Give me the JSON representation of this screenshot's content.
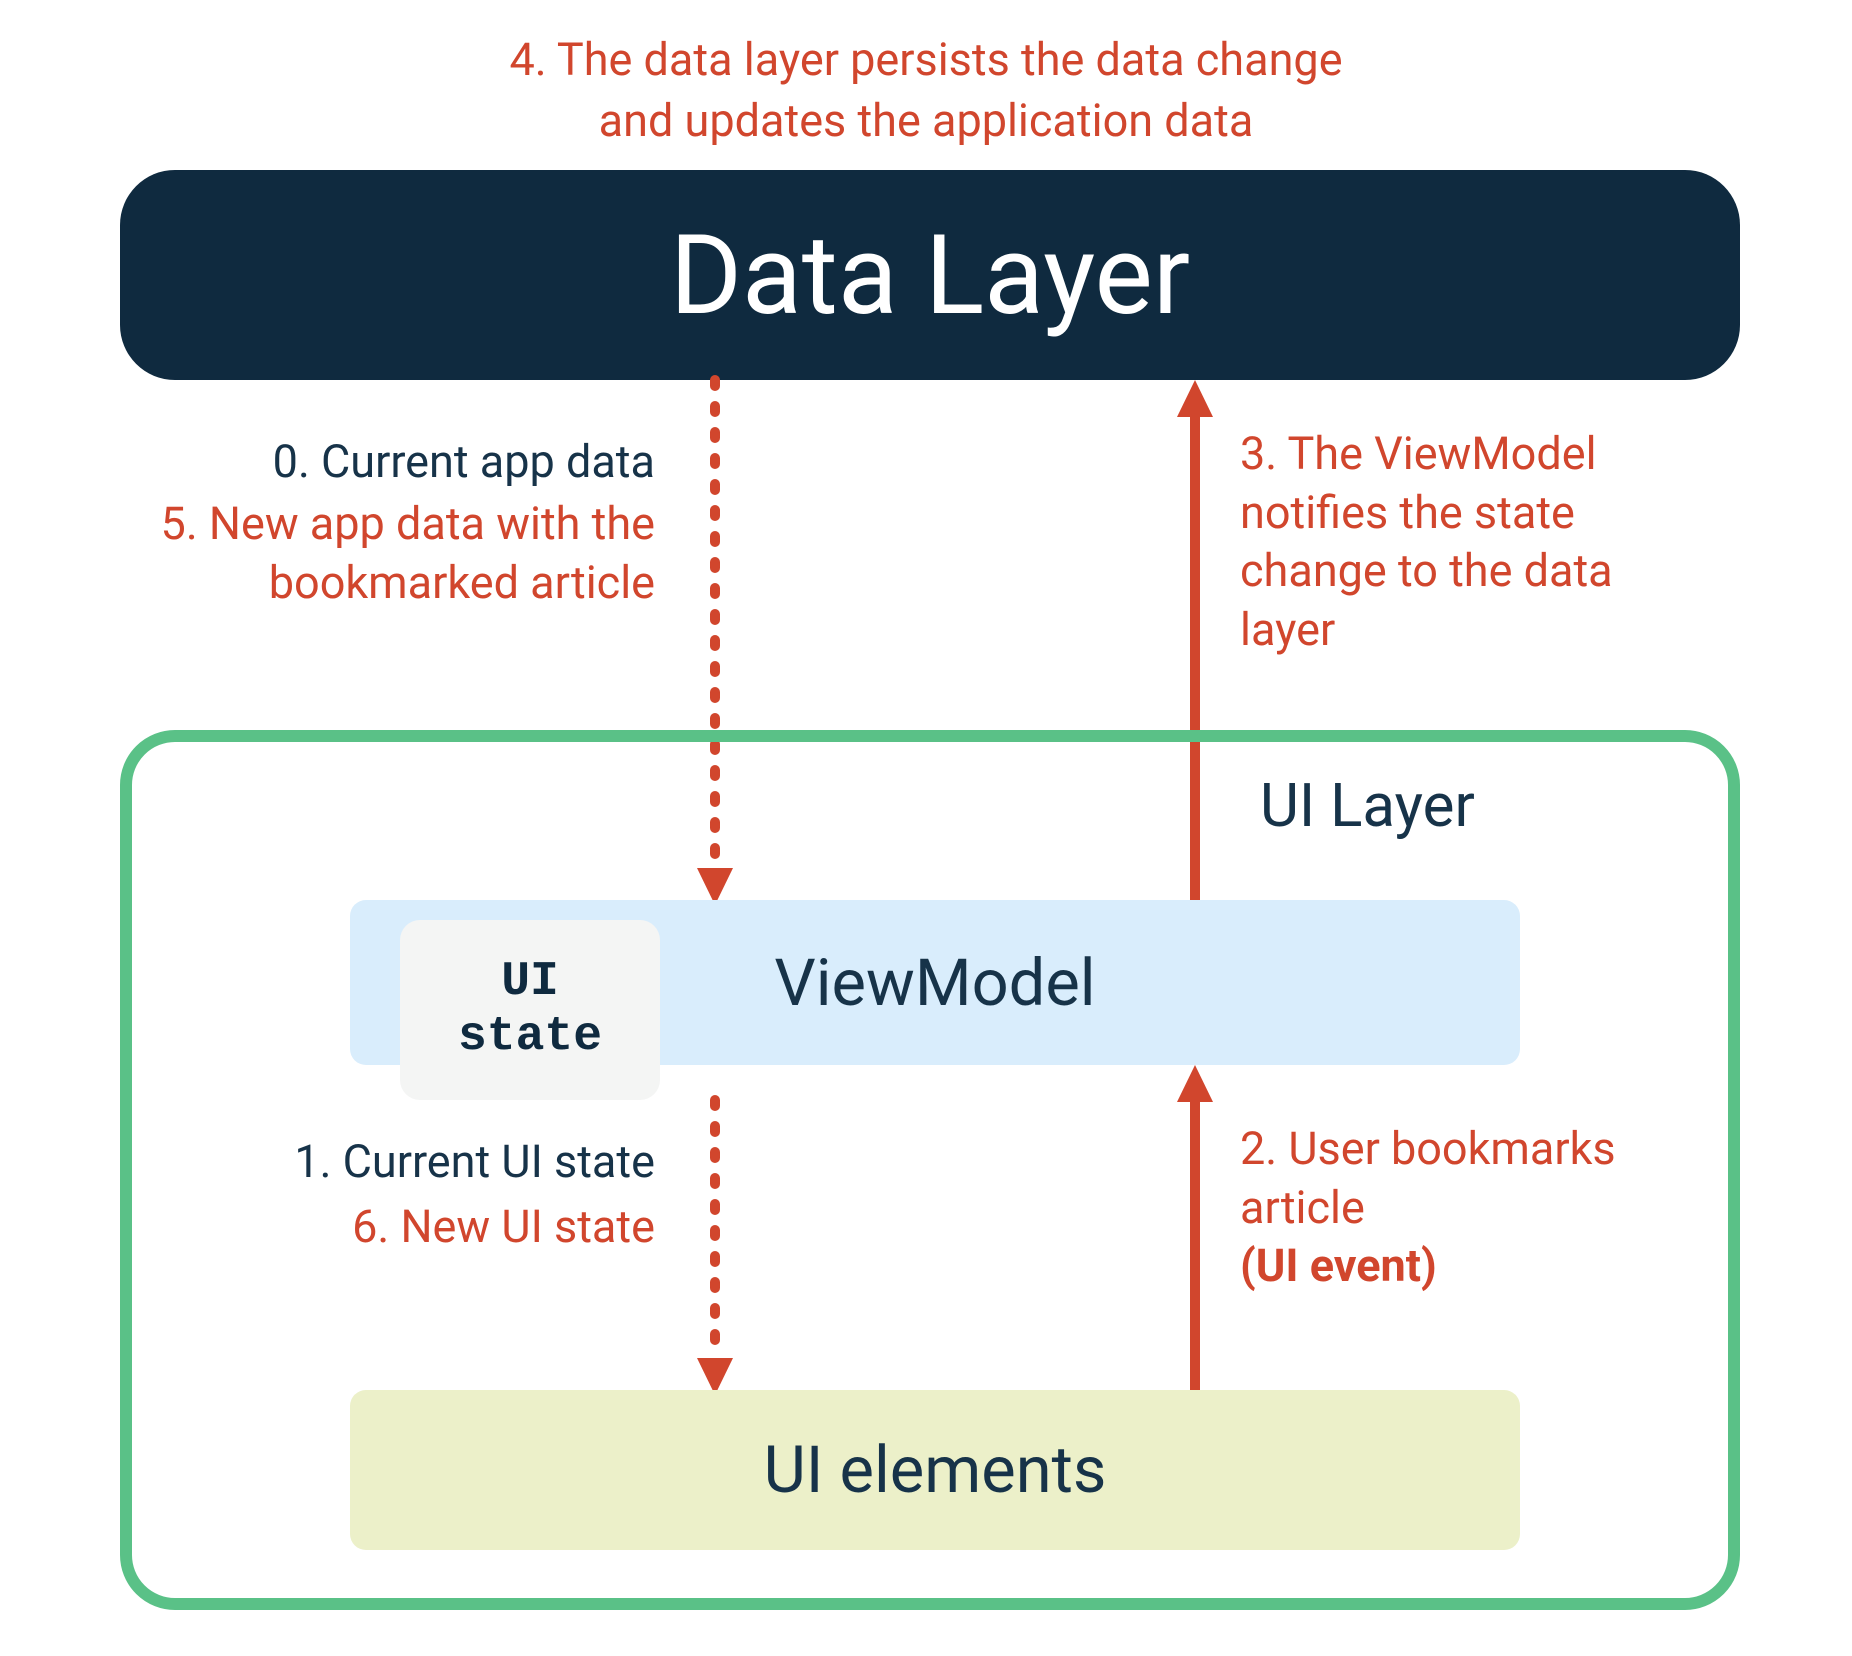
{
  "top_caption": "4. The data layer persists the data change\nand updates the application data",
  "data_layer": {
    "label": "Data Layer"
  },
  "ui_layer": {
    "label": "UI Layer"
  },
  "viewmodel": {
    "label": "ViewModel"
  },
  "ui_state": {
    "label": "UI\nstate"
  },
  "ui_elements": {
    "label": "UI elements"
  },
  "labels": {
    "l0": "0. Current app data",
    "l5": "5. New app data with the\nbookmarked article",
    "l1": "1. Current UI state",
    "l6": "6. New UI state",
    "l3": "3. The ViewModel notifies the state change to the data layer",
    "l2_pre": "2. User bookmarks article ",
    "l2_bold": "(UI event)"
  },
  "colors": {
    "accent_red": "#d1462d",
    "dark_navy": "#0f2a3f",
    "text_navy": "#173349",
    "green_border": "#5ac187",
    "viewmodel_bg": "#d9edfc",
    "uielements_bg": "#ecf0c9",
    "uistate_bg": "#f4f5f4"
  }
}
